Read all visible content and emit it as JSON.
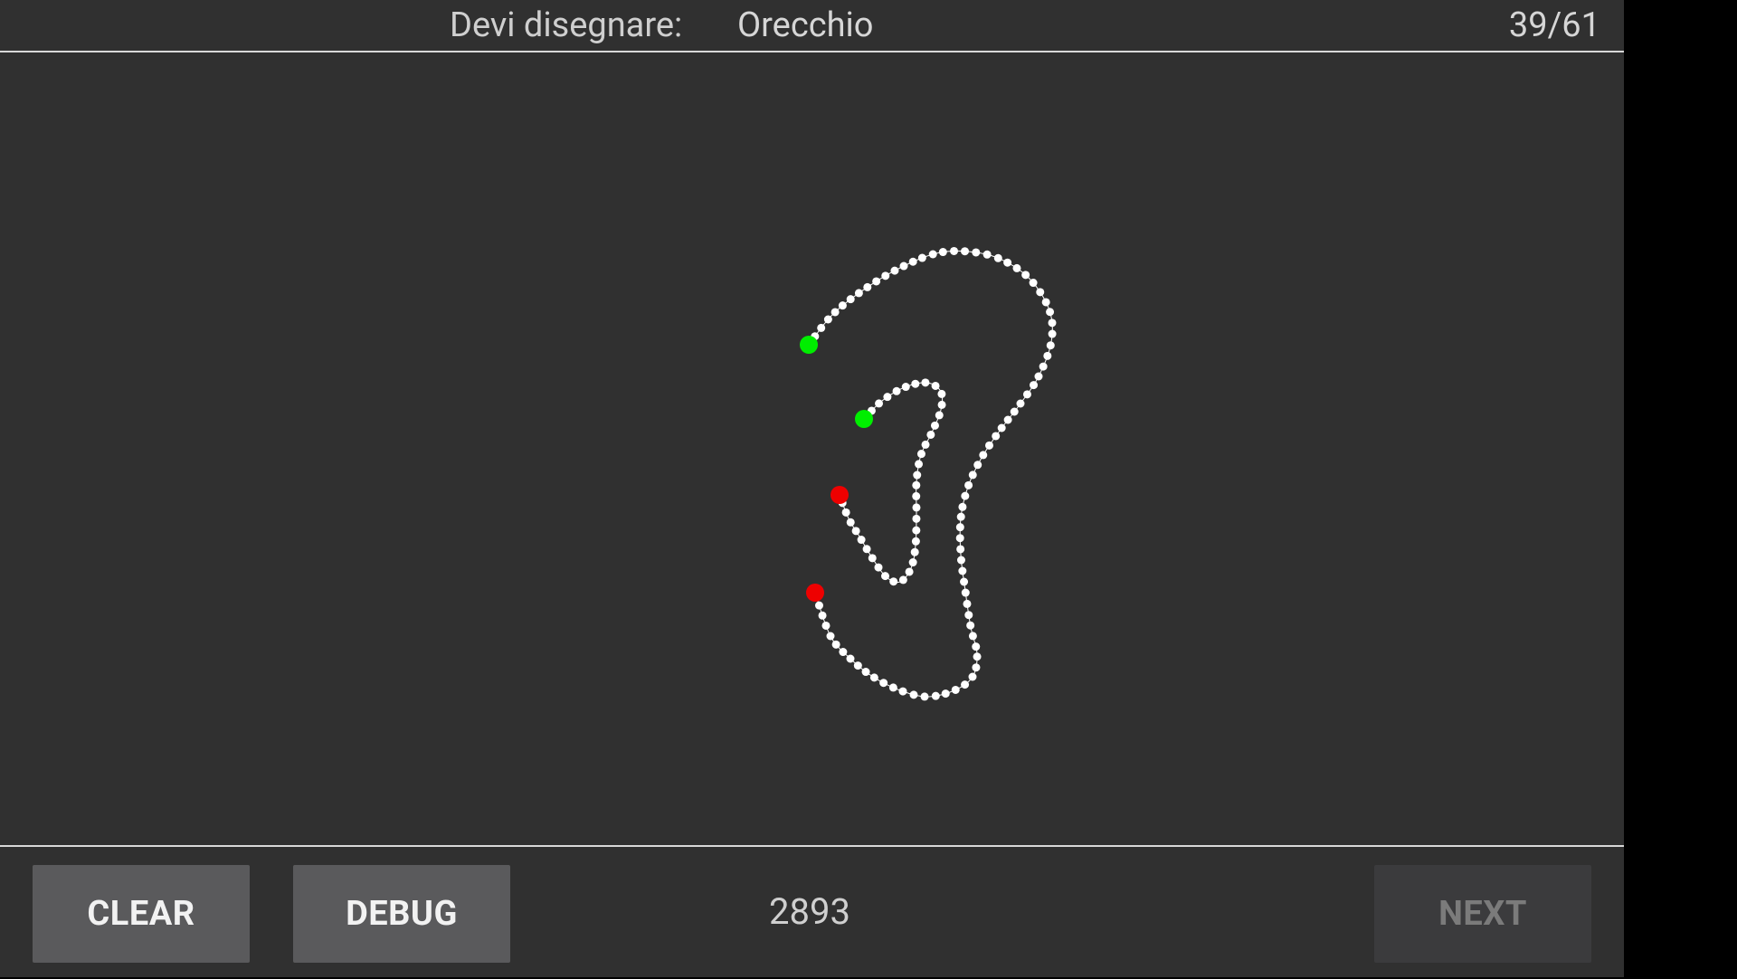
{
  "header": {
    "prompt_label": "Devi disegnare:",
    "prompt_word": "Orecchio",
    "progress": "39/61"
  },
  "footer": {
    "clear_label": "CLEAR",
    "debug_label": "DEBUG",
    "counter": "2893",
    "next_label": "NEXT",
    "next_enabled": false
  },
  "drawing": {
    "stroke_color": "#ffffff",
    "start_marker_color": "#00ee00",
    "end_marker_color": "#ee0000"
  }
}
